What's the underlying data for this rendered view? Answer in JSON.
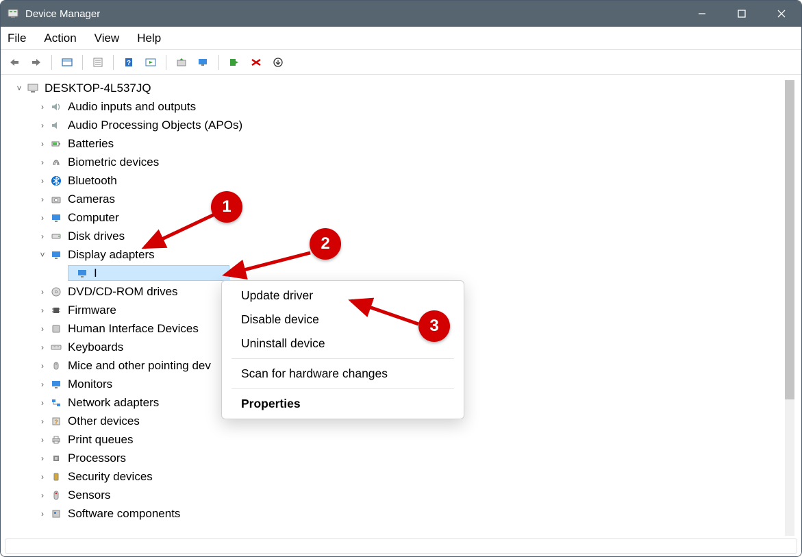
{
  "window": {
    "title": "Device Manager"
  },
  "menu": {
    "file": "File",
    "action": "Action",
    "view": "View",
    "help": "Help"
  },
  "tree": {
    "root": "DESKTOP-4L537JQ",
    "items": [
      "Audio inputs and outputs",
      "Audio Processing Objects (APOs)",
      "Batteries",
      "Biometric devices",
      "Bluetooth",
      "Cameras",
      "Computer",
      "Disk drives",
      "Display adapters",
      "DVD/CD-ROM drives",
      "Firmware",
      "Human Interface Devices",
      "Keyboards",
      "Mice and other pointing dev",
      "Monitors",
      "Network adapters",
      "Other devices",
      "Print queues",
      "Processors",
      "Security devices",
      "Sensors",
      "Software components"
    ],
    "selected_child": "I"
  },
  "context": {
    "update": "Update driver",
    "disable": "Disable device",
    "uninstall": "Uninstall device",
    "scan": "Scan for hardware changes",
    "properties": "Properties"
  },
  "annotations": {
    "b1": "1",
    "b2": "2",
    "b3": "3"
  }
}
